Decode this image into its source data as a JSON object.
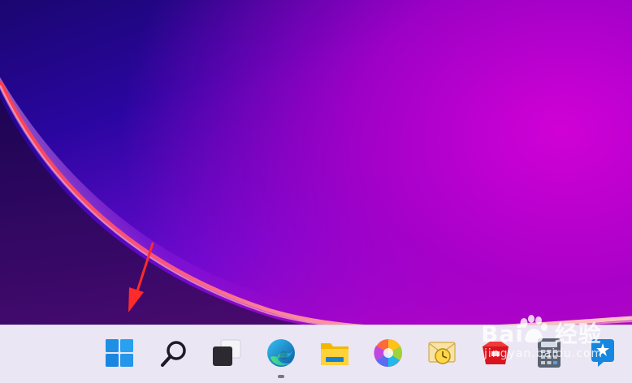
{
  "taskbar": {
    "icons": [
      {
        "name": "start-windows-icon"
      },
      {
        "name": "search-magnifier-icon"
      },
      {
        "name": "task-view-icon"
      },
      {
        "name": "edge-browser-icon"
      },
      {
        "name": "file-explorer-folder-icon"
      },
      {
        "name": "photos-pinwheel-icon"
      },
      {
        "name": "mail-clock-icon"
      },
      {
        "name": "red-app-icon"
      },
      {
        "name": "calculator-icon"
      },
      {
        "name": "blue-star-app-icon"
      }
    ],
    "running_app": "edge-browser-icon"
  },
  "annotation": {
    "arrow_color": "#ff2a2a",
    "points_to": "start-windows-icon"
  },
  "watermark": {
    "brand": "Bai",
    "brand_cn": "经验",
    "url": "jingyan.baidu.com"
  },
  "colors": {
    "taskbar_bg": "#eae6f3",
    "wallpaper_dark": "#1a0670",
    "wallpaper_magenta": "#c410c0"
  }
}
